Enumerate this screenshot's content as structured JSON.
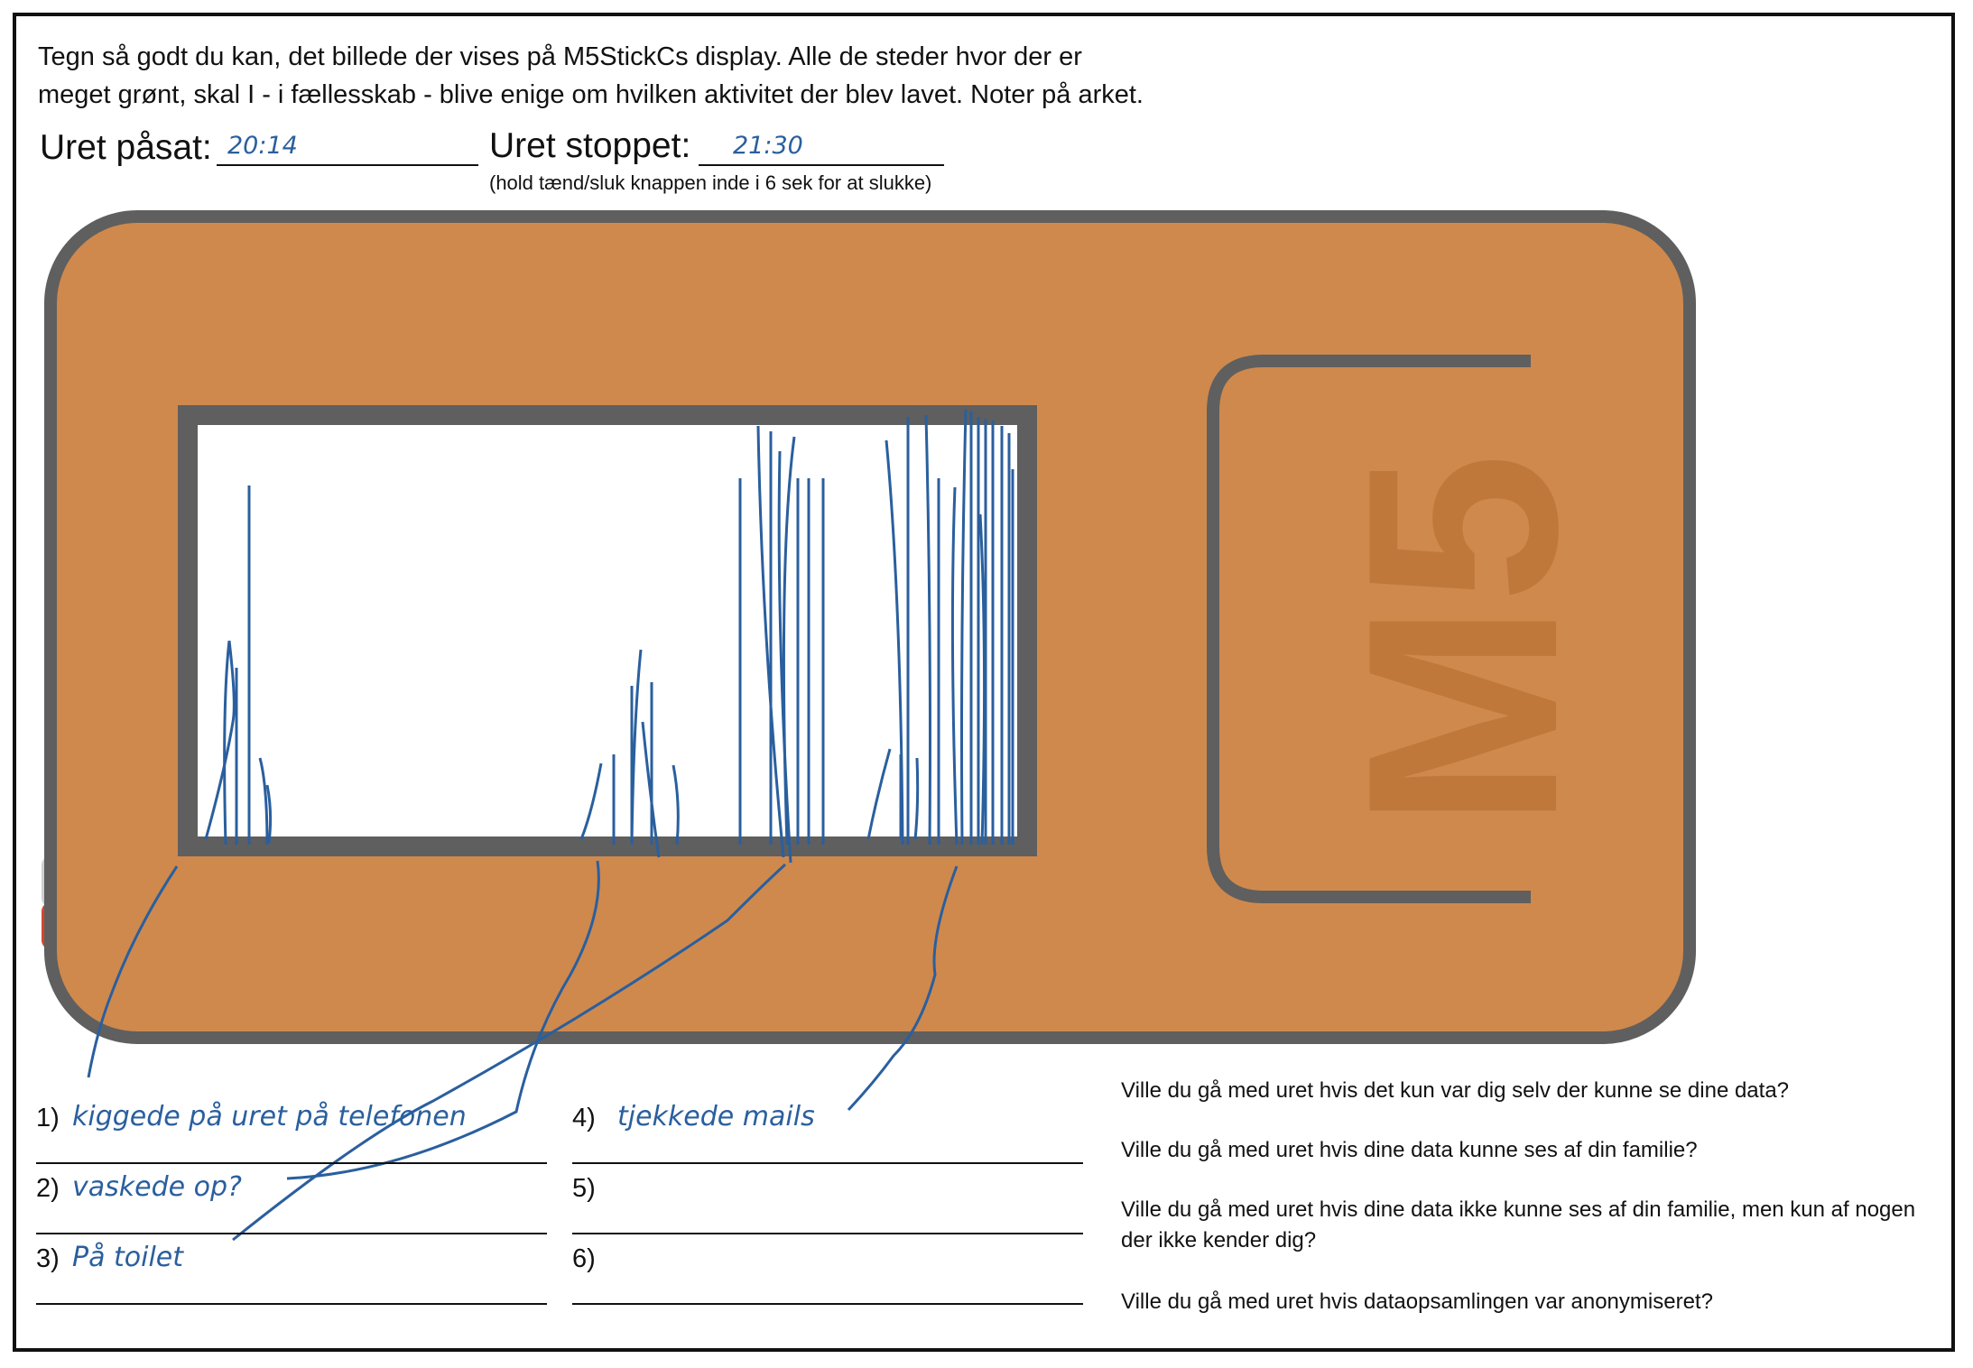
{
  "instructions": {
    "line1": "Tegn så godt du kan, det billede der vises på M5StickCs display. Alle de steder hvor der er",
    "line2": "meget grønt, skal I - i fællesskab - blive enige om hvilken aktivitet der blev lavet. Noter på arket."
  },
  "start": {
    "label": "Uret påsat:",
    "value": "20:14"
  },
  "stop": {
    "label": "Uret stoppet:",
    "value": "21:30"
  },
  "stop_note": "(hold tænd/sluk knappen inde i 6 sek for at slukke)",
  "device": {
    "logo": "M5",
    "body_color": "#cf894d",
    "frame_color": "#5f5f5f",
    "logo_color": "#c0783a",
    "button_color": "#d9442c",
    "ink_color": "#2a5f9e"
  },
  "answers": [
    {
      "num": "1)",
      "text": "kiggede på uret på telefonen"
    },
    {
      "num": "2)",
      "text": "vaskede op?"
    },
    {
      "num": "3)",
      "text": "På toilet"
    },
    {
      "num": "4)",
      "text": "tjekkede mails"
    },
    {
      "num": "5)",
      "text": ""
    },
    {
      "num": "6)",
      "text": ""
    }
  ],
  "questions": [
    "Ville du gå med uret hvis det kun var dig selv der kunne se dine data?",
    "Ville du gå med uret hvis dine data kunne ses af din familie?",
    "Ville du gå med uret hvis dine data ikke kunne ses af din familie, men kun af nogen der ikke kender dig?",
    "Ville du gå med uret hvis dataopsamlingen var anonymiseret?"
  ]
}
